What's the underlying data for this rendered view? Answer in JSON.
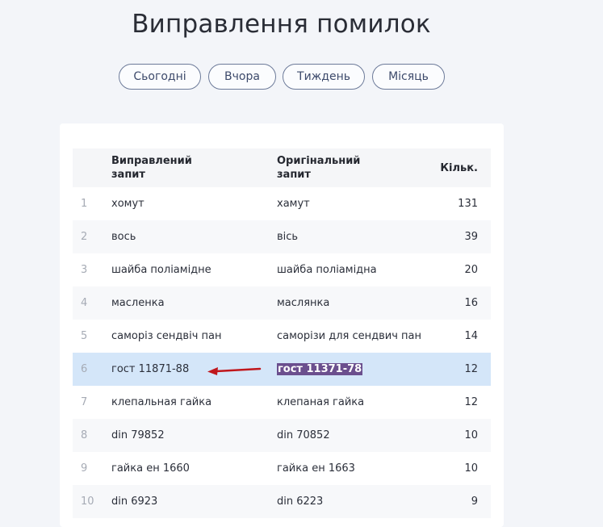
{
  "page": {
    "title": "Виправлення помилок"
  },
  "filters": [
    {
      "label": "Сьогодні"
    },
    {
      "label": "Вчора"
    },
    {
      "label": "Тиждень"
    },
    {
      "label": "Місяць"
    }
  ],
  "table": {
    "headers": {
      "index": "",
      "fixed_line1": "Виправлений",
      "fixed_line2": "запит",
      "original_line1": "Оригінальний",
      "original_line2": "запит",
      "count": "Кільк."
    },
    "rows": [
      {
        "index": "1",
        "fixed": "хомут",
        "original": "хамут",
        "count": "131"
      },
      {
        "index": "2",
        "fixed": "вось",
        "original": "вісь",
        "count": "39"
      },
      {
        "index": "3",
        "fixed": "шайба поліамідне",
        "original": "шайба поліамідна",
        "count": "20"
      },
      {
        "index": "4",
        "fixed": "масленка",
        "original": "маслянка",
        "count": "16"
      },
      {
        "index": "5",
        "fixed": "саморіз сендвіч пан",
        "original": "саморізи для сендвич пан",
        "count": "14"
      },
      {
        "index": "6",
        "fixed": "гост 11871-88",
        "original": "гост 11371-78",
        "count": "12"
      },
      {
        "index": "7",
        "fixed": "клепальная гайка",
        "original": "клепаная гайка",
        "count": "12"
      },
      {
        "index": "8",
        "fixed": "din 79852",
        "original": "din 70852",
        "count": "10"
      },
      {
        "index": "9",
        "fixed": "гайка ен 1660",
        "original": "гайка ен 1663",
        "count": "10"
      },
      {
        "index": "10",
        "fixed": "din 6923",
        "original": "din 6223",
        "count": "9"
      }
    ]
  },
  "selection": {
    "row_index": 6,
    "highlight_color": "#6b4f8e",
    "row_color": "#d4e6f9",
    "arrow_color": "#c0171c"
  }
}
